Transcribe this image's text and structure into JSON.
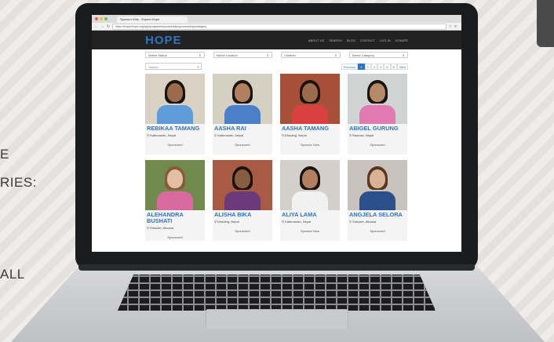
{
  "side_texts": [
    "E",
    "RIES:",
    "ALL"
  ],
  "browser": {
    "tab_title": "Sponsor Kids - Expect Hope",
    "url": "https://expecthope.org/app/programs/sponsorship/sponsorships/category"
  },
  "site": {
    "logo": "HOPE",
    "nav": [
      "ABOUT US",
      "SEARCH",
      "BLOG",
      "CONTACT",
      "LOG IN",
      "DONATE"
    ]
  },
  "filters": [
    "Select Status",
    "Select Location",
    "Children",
    "Select Category"
  ],
  "search": {
    "placeholder": "Search"
  },
  "pagination": {
    "items": [
      "Previous",
      "1",
      "2",
      "3",
      "4",
      "5",
      "6",
      "Next"
    ],
    "active": "1"
  },
  "children": [
    {
      "name": "REBIKAA TAMANG",
      "location": "Kathmandu, Nepal",
      "status": "Sponsored",
      "bg": "#d9d2c4",
      "skin": "#9a6b4c",
      "hair": "#1a1411",
      "shirt": "#5f9bd8"
    },
    {
      "name": "AASHA RAI",
      "location": "Kathmandu, Nepal",
      "status": "Sponsored",
      "bg": "#d6d0c2",
      "skin": "#b08060",
      "hair": "#1a1411",
      "shirt": "#4a80c8"
    },
    {
      "name": "AASHA TAMANG",
      "location": "Dhading, Nepal",
      "status": "Sponsor Now",
      "bg": "#a6503a",
      "skin": "#9a6b4c",
      "hair": "#1a1411",
      "shirt": "#d94040"
    },
    {
      "name": "ABIGEL GURUNG",
      "location": "Rasuwa, Nepal",
      "status": "Sponsored",
      "bg": "#cfd3d1",
      "skin": "#b48a68",
      "hair": "#1a1411",
      "shirt": "#e07ab0"
    },
    {
      "name": "ALEHANDRA BUSHATI",
      "location": "Shkoder, Albania",
      "status": "Sponsored",
      "bg": "#6f8a4c",
      "skin": "#e2bfa3",
      "hair": "#8a5a36",
      "shirt": "#d96aa0"
    },
    {
      "name": "ALISHA BIKA",
      "location": "Dhading, Nepal",
      "status": "Sponsored",
      "bg": "#a85a42",
      "skin": "#8a5d40",
      "hair": "#1a1411",
      "shirt": "#6a3a7a"
    },
    {
      "name": "ALIYA LAMA",
      "location": "Kathmandu, Nepal",
      "status": "Sponsor Now",
      "bg": "#d2d0c9",
      "skin": "#b08060",
      "hair": "#1a1411",
      "shirt": "#f1f1f1"
    },
    {
      "name": "ANGJELA SELORA",
      "location": "Shkoder, Albania",
      "status": "Sponsored",
      "bg": "#c7c3bc",
      "skin": "#d8b294",
      "hair": "#5a3620",
      "shirt": "#2a4f8a"
    }
  ]
}
